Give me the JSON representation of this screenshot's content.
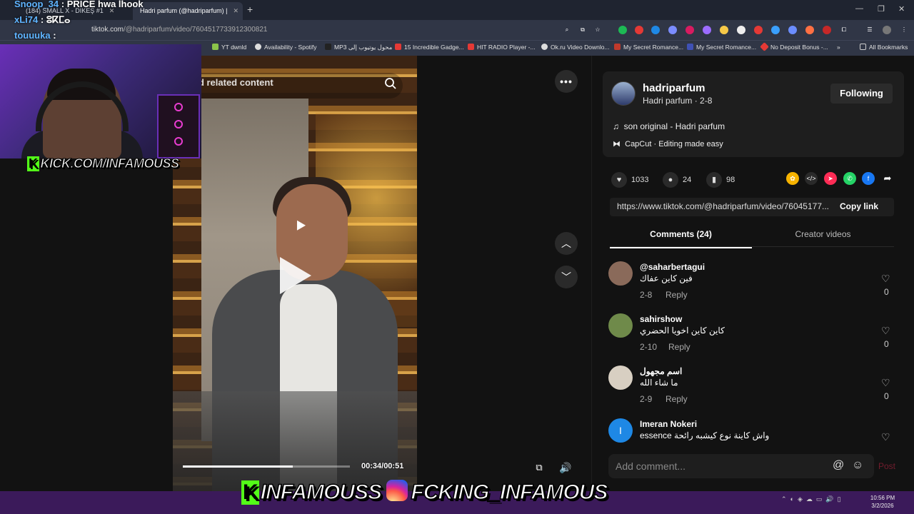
{
  "browser": {
    "tabs": [
      {
        "label": "(184) SMALL X - DIKEŞ #1"
      },
      {
        "label": "Hadri parfum (@hadriparfum) |"
      }
    ],
    "url_host": "tiktok.com",
    "url_path": "/@hadriparfum/video/7604517733912300821",
    "bookmarks": [
      {
        "label": "YT dwnld"
      },
      {
        "label": "Availability - Spotify"
      },
      {
        "label": "MP3 محول يوتيوب إلى"
      },
      {
        "label": "15 Incredible Gadge..."
      },
      {
        "label": "HIT RADIO Player -..."
      },
      {
        "label": "Ok.ru Video Downlo..."
      },
      {
        "label": "My Secret Romance..."
      },
      {
        "label": "My Secret Romance..."
      },
      {
        "label": "No Deposit Bonus -..."
      },
      {
        "label": "»"
      },
      {
        "label": "All Bookmarks"
      }
    ]
  },
  "stream": {
    "chat": [
      {
        "name": "Snoop_34",
        "text": ": PRICE hwa lhook"
      },
      {
        "name": "xLi74",
        "text": ": ⵓⴽⵎⴰ"
      },
      {
        "name": "touuuka",
        "text": ":"
      }
    ],
    "kick_banner": "KICK.COM/INFAMOUSS",
    "bottom_tag_kick": "INFAMOUSS",
    "bottom_tag_ig": "FCKING_INFAMOUS"
  },
  "video": {
    "search_placeholder": "nd related content",
    "time": "00:34/00:51",
    "progress_fraction": 0.66
  },
  "author": {
    "handle": "hadriparfum",
    "subtitle": "Hadri parfum · 2-8",
    "follow_label": "Following",
    "music": "son original - Hadri parfum",
    "capcut": "CapCut · Editing made easy"
  },
  "stats": {
    "likes": "1033",
    "comments": "24",
    "saves": "98"
  },
  "share_link": {
    "url": "https://www.tiktok.com/@hadriparfum/video/76045177...",
    "copy_label": "Copy link"
  },
  "tabs": {
    "comments": "Comments (24)",
    "creator": "Creator videos"
  },
  "comments": [
    {
      "name": "@saharbertagui",
      "text": "فين كاين عفاك",
      "date": "2-8",
      "reply": "Reply",
      "likes": "0",
      "avatar_color": "#8a6a5a"
    },
    {
      "name": "sahirshow",
      "text": "كاين كاين اخويا الحضري",
      "date": "2-10",
      "reply": "Reply",
      "likes": "0",
      "avatar_color": "#6f8a4a"
    },
    {
      "name": "اسم مجهول",
      "text": "ما شاء الله",
      "date": "2-9",
      "reply": "Reply",
      "likes": "0",
      "avatar_color": "#d8cfc2"
    },
    {
      "name": "Imeran Nokeri",
      "text": "essence واش كاينة نوع كيشبه رائحة",
      "date": "",
      "reply": "",
      "likes": "",
      "avatar_color": "#1e88e5",
      "avatar_letter": "I"
    }
  ],
  "composer": {
    "placeholder": "Add comment...",
    "post_label": "Post"
  },
  "taskbar": {
    "time": "10:56 PM",
    "date": "3/2/2026"
  },
  "colors": {
    "accent_post": "#fe2c55",
    "kick_green": "#53fc18",
    "page_bg": "#121212"
  }
}
